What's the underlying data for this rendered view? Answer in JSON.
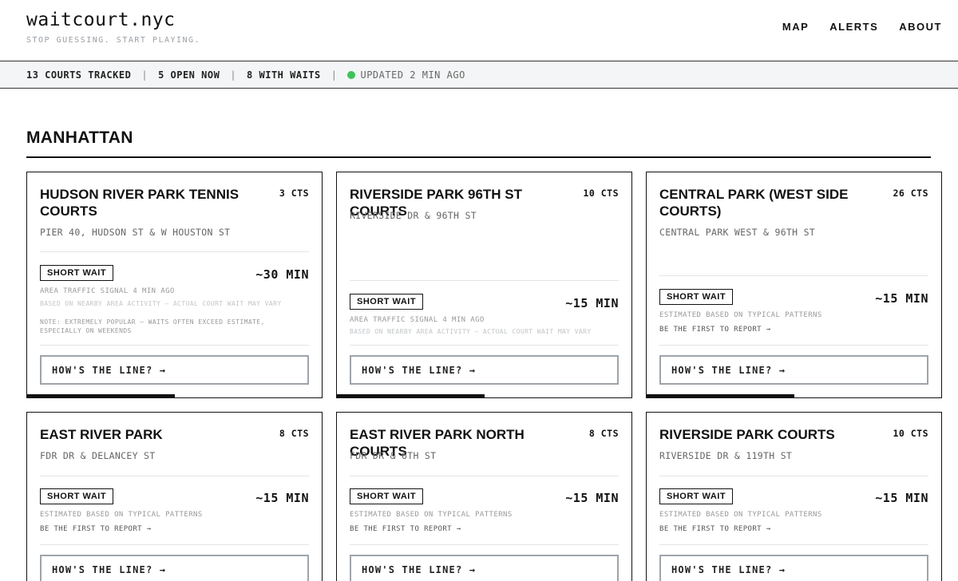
{
  "header": {
    "logo": "waitcourt.nyc",
    "tagline": "STOP GUESSING. START PLAYING.",
    "nav": [
      "MAP",
      "ALERTS",
      "ABOUT"
    ]
  },
  "status": {
    "courts_tracked": "13 COURTS TRACKED",
    "open_now": "5 OPEN NOW",
    "with_waits": "8 WITH WAITS",
    "updated": "UPDATED 2 MIN AGO",
    "separator": "|",
    "live_color": "#3cc45a"
  },
  "section": {
    "title": "MANHATTAN"
  },
  "cards": [
    {
      "name": "HUDSON RIVER PARK TENNIS COURTS",
      "courts": "3 CTS",
      "address": "PIER 40, HUDSON ST & W HOUSTON ST",
      "badge": "SHORT WAIT",
      "wait": "~30 MIN",
      "signal": "AREA TRAFFIC SIGNAL 4 MIN AGO",
      "disclaimer": "BASED ON NEARBY AREA ACTIVITY — ACTUAL COURT WAIT MAY VARY",
      "extra_note": "NOTE: EXTREMELY POPULAR — WAITS OFTEN EXCEED ESTIMATE, ESPECIALLY ON WEEKENDS",
      "button": "HOW'S THE LINE? →",
      "progress": 0.5
    },
    {
      "name": "RIVERSIDE PARK 96TH ST COURTS",
      "courts": "10 CTS",
      "address": "RIVERSIDE DR & 96TH ST",
      "badge": "SHORT WAIT",
      "wait": "~15 MIN",
      "signal": "AREA TRAFFIC SIGNAL 4 MIN AGO",
      "disclaimer": "BASED ON NEARBY AREA ACTIVITY — ACTUAL COURT WAIT MAY VARY",
      "button": "HOW'S THE LINE? →",
      "progress": 0.5
    },
    {
      "name": "CENTRAL PARK (WEST SIDE COURTS)",
      "courts": "26 CTS",
      "address": "CENTRAL PARK WEST & 96TH ST",
      "badge": "SHORT WAIT",
      "wait": "~15 MIN",
      "estimate": "ESTIMATED BASED ON TYPICAL PATTERNS",
      "report": "BE THE FIRST TO REPORT →",
      "button": "HOW'S THE LINE? →",
      "progress": 0.5
    },
    {
      "name": "EAST RIVER PARK",
      "courts": "8 CTS",
      "address": "FDR DR & DELANCEY ST",
      "badge": "SHORT WAIT",
      "wait": "~15 MIN",
      "estimate": "ESTIMATED BASED ON TYPICAL PATTERNS",
      "report": "BE THE FIRST TO REPORT →",
      "button": "HOW'S THE LINE? →"
    },
    {
      "name": "EAST RIVER PARK NORTH COURTS",
      "courts": "8 CTS",
      "address": "FDR DR & 6TH ST",
      "badge": "SHORT WAIT",
      "wait": "~15 MIN",
      "estimate": "ESTIMATED BASED ON TYPICAL PATTERNS",
      "report": "BE THE FIRST TO REPORT →",
      "button": "HOW'S THE LINE? →"
    },
    {
      "name": "RIVERSIDE PARK COURTS",
      "courts": "10 CTS",
      "address": "RIVERSIDE DR & 119TH ST",
      "badge": "SHORT WAIT",
      "wait": "~15 MIN",
      "estimate": "ESTIMATED BASED ON TYPICAL PATTERNS",
      "report": "BE THE FIRST TO REPORT →",
      "button": "HOW'S THE LINE? →"
    }
  ]
}
